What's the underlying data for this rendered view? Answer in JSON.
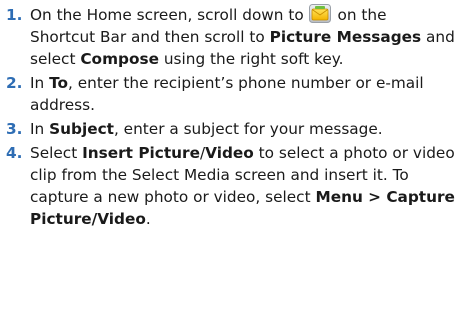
{
  "colors": {
    "step_number": "#2e6db4",
    "text": "#1a1a1a",
    "icon_fill": "#ffd21a",
    "icon_frame": "#c9ccd1"
  },
  "steps": [
    {
      "number": "1.",
      "parts": {
        "a": "On the Home screen, scroll down to",
        "icon": "picture-messages-icon",
        "b": "on the Shortcut Bar and then scroll to",
        "c": "Picture Messages",
        "d": "and select",
        "e": "Compose",
        "f": "using the right soft key."
      }
    },
    {
      "number": "2.",
      "parts": {
        "a": "In",
        "b": "To",
        "c": ", enter the recipient’s phone number or e-mail address."
      }
    },
    {
      "number": "3.",
      "parts": {
        "a": "In",
        "b": "Subject",
        "c": ", enter a subject for your message."
      }
    },
    {
      "number": "4.",
      "parts": {
        "a": "Select",
        "b": "Insert Picture",
        "c": "/",
        "d": "Video",
        "e": "to select a photo or video clip from the Select Media screen and insert it. To capture a new photo or video, select",
        "f": "Menu > Capture Picture/Video",
        "g": "."
      }
    }
  ]
}
